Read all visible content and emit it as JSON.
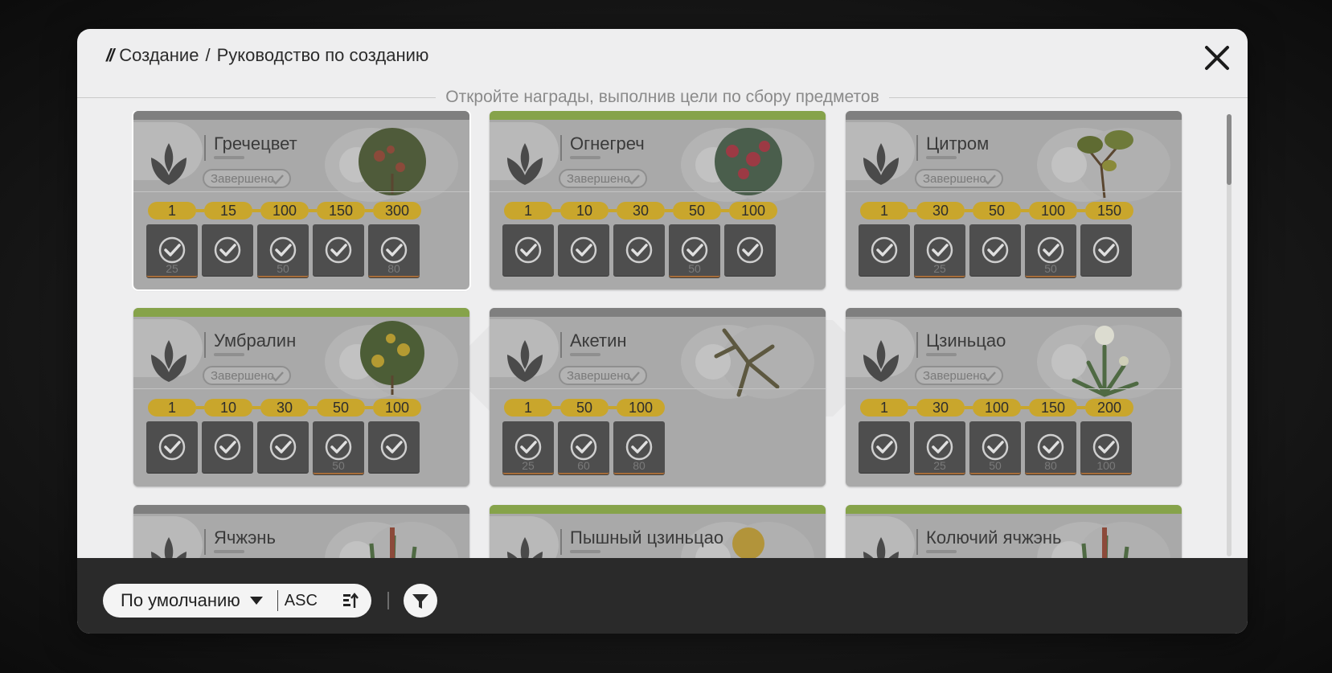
{
  "header": {
    "breadcrumb": [
      "Создание",
      "Руководство по созданию"
    ],
    "separator": "/",
    "subtitle": "Откройте награды, выполнив цели по сбору предметов"
  },
  "accent_colors": {
    "completed_bar": "#86a34a",
    "milestone": "#c9a62c",
    "reward_tile": "#4e4e4e"
  },
  "cards": [
    {
      "name": "Гречецвет",
      "status": "Завершено",
      "complete": false,
      "selected": true,
      "plant": "red-berry-shrub",
      "milestones": [
        "1",
        "15",
        "100",
        "150",
        "300"
      ],
      "rewards": [
        "25",
        "",
        "50",
        "",
        "80"
      ]
    },
    {
      "name": "Огнегреч",
      "status": "Завершено",
      "complete": true,
      "selected": false,
      "plant": "red-fruit-bush",
      "milestones": [
        "1",
        "10",
        "30",
        "50",
        "100"
      ],
      "rewards": [
        "",
        "",
        "",
        "50",
        ""
      ]
    },
    {
      "name": "Цитром",
      "status": "Завершено",
      "complete": false,
      "selected": false,
      "plant": "yellow-leaf-branch",
      "milestones": [
        "1",
        "30",
        "50",
        "100",
        "150"
      ],
      "rewards": [
        "",
        "25",
        "",
        "50",
        ""
      ]
    },
    {
      "name": "Умбралин",
      "status": "Завершено",
      "complete": true,
      "selected": false,
      "plant": "yellow-fruit-tree",
      "milestones": [
        "1",
        "10",
        "30",
        "50",
        "100"
      ],
      "rewards": [
        "",
        "",
        "",
        "50",
        ""
      ]
    },
    {
      "name": "Акетин",
      "status": "Завершено",
      "complete": false,
      "selected": false,
      "plant": "dry-thorn-branch",
      "milestones": [
        "1",
        "50",
        "100"
      ],
      "rewards": [
        "25",
        "60",
        "80"
      ]
    },
    {
      "name": "Цзиньцао",
      "status": "Завершено",
      "complete": false,
      "selected": false,
      "plant": "white-flower-plant",
      "milestones": [
        "1",
        "30",
        "100",
        "150",
        "200"
      ],
      "rewards": [
        "",
        "25",
        "50",
        "80",
        "100"
      ]
    },
    {
      "name": "Ячжэнь",
      "complete": false,
      "plant": "red-spike-plant"
    },
    {
      "name": "Пышный цзиньцао",
      "complete": true,
      "plant": "golden-flower"
    },
    {
      "name": "Колючий ячжэнь",
      "complete": true,
      "plant": "red-spike-plant"
    }
  ],
  "footer": {
    "sort_label": "По умолчанию",
    "sort_order": "ASC"
  },
  "icons": {
    "close": "close-icon",
    "leaf": "leaf-icon",
    "check": "check-icon",
    "sort_toggle": "sort-order-icon",
    "filter": "filter-icon",
    "dropdown": "caret-down-icon"
  }
}
